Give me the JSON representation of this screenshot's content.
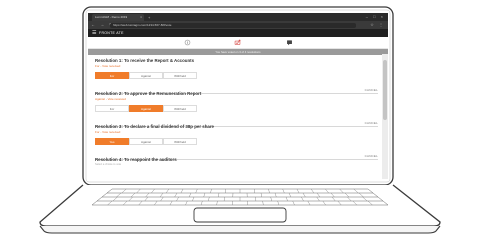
{
  "browser": {
    "tab_title": "Lumi AGM - Demo 2019",
    "tab_close": "×",
    "new_tab": "+",
    "window_controls": "– □ ×",
    "nav_buttons": "← → ↻ ⌂",
    "url": "https://web.lumiagm.com/1234-567-8/#/vote",
    "extensions": "☆ ⋮"
  },
  "app": {
    "menu_glyph": "☰",
    "title": "FRONTE ATE"
  },
  "icons": [
    "info-icon",
    "vote-icon",
    "qa-icon"
  ],
  "notice": "You have voted on 3 of 4 resolutions",
  "resolutions": [
    {
      "title": "Resolution 1: To receive the Report & Accounts",
      "status": "For - Vote received",
      "options": [
        "For",
        "Against",
        "Withheld"
      ],
      "selected": "For",
      "cancel": "CANCEL"
    },
    {
      "title": "Resolution 2: To approve the Remuneration Report",
      "status": "Against - Vote received",
      "options": [
        "For",
        "Against",
        "Withheld"
      ],
      "selected": "Against",
      "cancel": "CANCEL"
    },
    {
      "title": "Resolution 3: To declare a final dividend of 38p per share",
      "status": "For - Vote received",
      "options": [
        "Yes",
        "Against",
        "Withheld"
      ],
      "selected": "Yes",
      "cancel": "CANCEL"
    },
    {
      "title": "Resolution 4: To reappoint the auditors",
      "status": "Select a choice to vote"
    }
  ],
  "colors": {
    "accent": "#f07c2a",
    "appbar": "#1f1f1f",
    "tabbar": "#2b2b2b",
    "notice": "#9a9a9a"
  }
}
